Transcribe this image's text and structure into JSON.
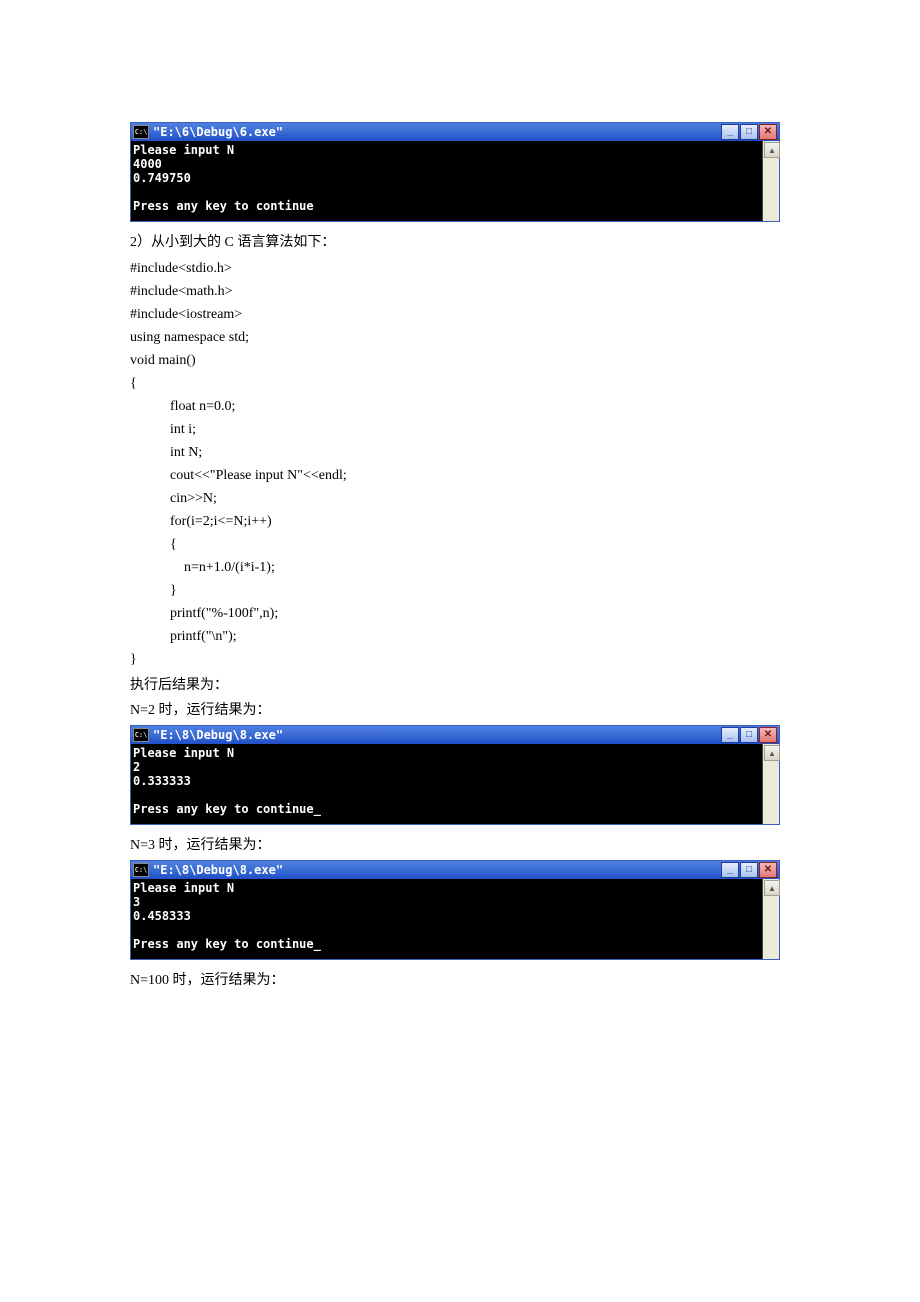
{
  "console1": {
    "title": "\"E:\\6\\Debug\\6.exe\"",
    "lines": "Please input N\n4000\n0.749750\n\nPress any key to continue"
  },
  "text": {
    "heading_algo": "2）从小到大的 C 语言算法如下：",
    "after_code1": "执行后结果为：",
    "n2_caption": "N=2 时，运行结果为：",
    "n3_caption": "N=3 时，运行结果为：",
    "n100_caption": "N=100 时，运行结果为："
  },
  "code": {
    "l1": "#include<stdio.h>",
    "l2": "#include<math.h>",
    "l3": "#include<iostream>",
    "l4": "using namespace std;",
    "l5": "void main()",
    "l6": "{",
    "l7": "float n=0.0;",
    "l8": "int i;",
    "l9": "int N;",
    "l10": "cout<<\"Please input N\"<<endl;",
    "l11": "cin>>N;",
    "l12": "for(i=2;i<=N;i++)",
    "l13": "{",
    "l14": "    n=n+1.0/(i*i-1);",
    "l15": "}",
    "l16": "printf(\"%-100f\",n);",
    "l17": "printf(\"\\n\");",
    "l18": "",
    "l19": "}"
  },
  "console2": {
    "title": "\"E:\\8\\Debug\\8.exe\"",
    "lines": "Please input N\n2\n0.333333\n\nPress any key to continue_\n"
  },
  "console3": {
    "title": "\"E:\\8\\Debug\\8.exe\"",
    "lines": "Please input N\n3\n0.458333\n\nPress any key to continue_\n"
  },
  "winbtns": {
    "min": "_",
    "max": "□",
    "close": "✕",
    "up": "▲"
  }
}
